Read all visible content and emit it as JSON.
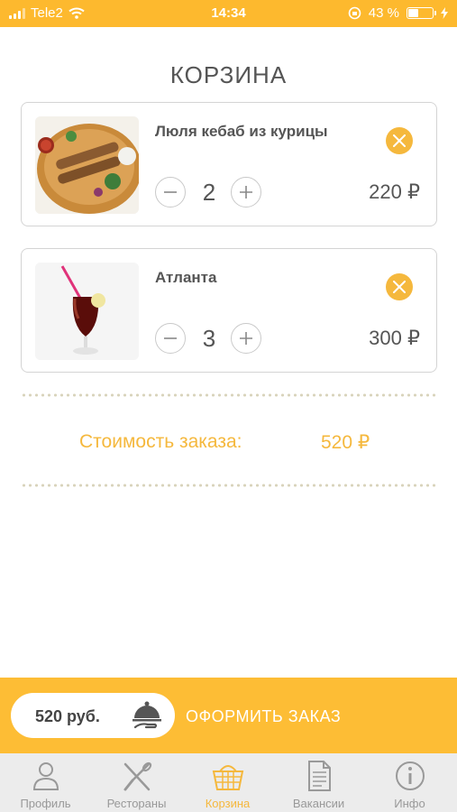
{
  "status_bar": {
    "carrier": "Tele2",
    "time": "14:34",
    "battery": "43 %"
  },
  "title": "КОРЗИНА",
  "cart": {
    "items": [
      {
        "name": "Люля кебаб из курицы",
        "quantity": "2",
        "price": "220 ₽",
        "image": "kebab-plate"
      },
      {
        "name": "Атланта",
        "quantity": "3",
        "price": "300 ₽",
        "image": "drink-glass"
      }
    ]
  },
  "summary": {
    "label": "Стоимость заказа:",
    "value": "520 ₽"
  },
  "order": {
    "sum": "520 руб.",
    "button_label": "ОФОРМИТЬ ЗАКАЗ"
  },
  "tabs": [
    {
      "label": "Профиль",
      "icon": "person-icon"
    },
    {
      "label": "Рестораны",
      "icon": "fork-knife-icon"
    },
    {
      "label": "Корзина",
      "icon": "basket-icon",
      "active": true
    },
    {
      "label": "Вакансии",
      "icon": "document-icon"
    },
    {
      "label": "Инфо",
      "icon": "info-icon"
    }
  ],
  "colors": {
    "accent": "#fdb92e",
    "text": "#555555",
    "tab_inactive": "#999999"
  }
}
